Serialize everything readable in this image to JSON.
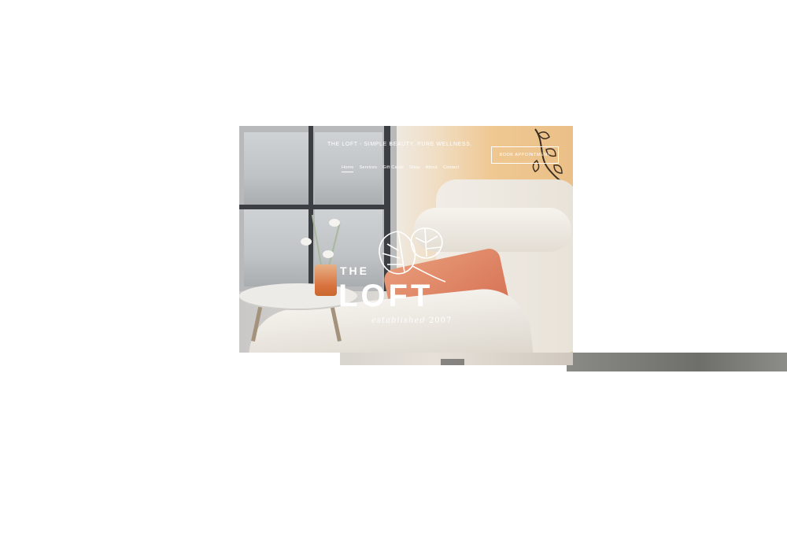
{
  "header": {
    "tagline": "THE LOFT - SIMPLE BEAUTY. PURE WELLNESS.",
    "book_button": "BOOK APPOINTMENT"
  },
  "nav": {
    "items": [
      "Home",
      "Services",
      "Gift Cards",
      "Shop",
      "About",
      "Contact"
    ],
    "active": "Home"
  },
  "logo": {
    "prefix": "THE",
    "name": "LOFT",
    "established_script": "established",
    "established_year": "2007"
  },
  "colors": {
    "overlay_text": "#ffffff",
    "cushion": "#d9795a",
    "wall": "#ebc088"
  }
}
